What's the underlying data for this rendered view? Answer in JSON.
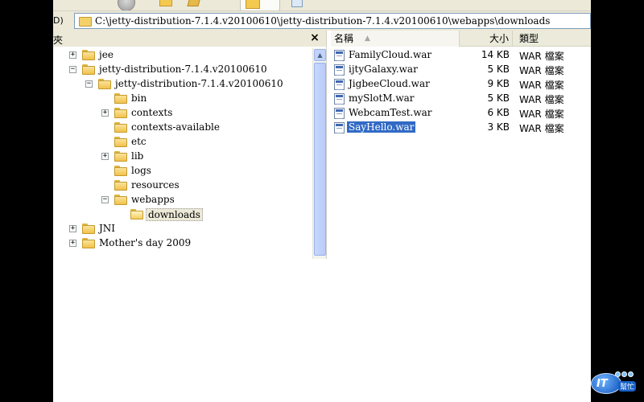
{
  "address": {
    "label": "D)",
    "path": "C:\\jetty-distribution-7.1.4.v20100610\\jetty-distribution-7.1.4.v20100610\\webapps\\downloads"
  },
  "folders_pane": {
    "title": "夾",
    "close_label": "×"
  },
  "tree": [
    {
      "label": "jee",
      "expander": "+",
      "level": 1
    },
    {
      "label": "jetty-distribution-7.1.4.v20100610",
      "expander": "−",
      "level": 1
    },
    {
      "label": "jetty-distribution-7.1.4.v20100610",
      "expander": "−",
      "level": 2
    },
    {
      "label": "bin",
      "expander": "",
      "level": 3
    },
    {
      "label": "contexts",
      "expander": "+",
      "level": 3
    },
    {
      "label": "contexts-available",
      "expander": "",
      "level": 3
    },
    {
      "label": "etc",
      "expander": "",
      "level": 3
    },
    {
      "label": "lib",
      "expander": "+",
      "level": 3
    },
    {
      "label": "logs",
      "expander": "",
      "level": 3
    },
    {
      "label": "resources",
      "expander": "",
      "level": 3
    },
    {
      "label": "webapps",
      "expander": "−",
      "level": 3
    },
    {
      "label": "downloads",
      "expander": "",
      "level": 4,
      "selected": true
    },
    {
      "label": "JNI",
      "expander": "+",
      "level": 1
    },
    {
      "label": "Mother's day 2009",
      "expander": "+",
      "level": 1
    }
  ],
  "files_pane": {
    "columns": {
      "name": "名稱",
      "size": "大小",
      "type": "類型"
    },
    "sort_indicator": "▲",
    "files": [
      {
        "name": "FamilyCloud.war",
        "size": "14 KB",
        "type": "WAR 檔案"
      },
      {
        "name": "ijtyGalaxy.war",
        "size": "5 KB",
        "type": "WAR 檔案"
      },
      {
        "name": "JigbeeCloud.war",
        "size": "9 KB",
        "type": "WAR 檔案"
      },
      {
        "name": "mySlotM.war",
        "size": "5 KB",
        "type": "WAR 檔案"
      },
      {
        "name": "WebcamTest.war",
        "size": "6 KB",
        "type": "WAR 檔案"
      },
      {
        "name": "SayHello.war",
        "size": "3 KB",
        "type": "WAR 檔案",
        "selected": true
      }
    ]
  },
  "watermark": {
    "brand": "IT",
    "tail": "幫忙"
  },
  "colors": {
    "selection": "#316ac5",
    "chrome": "#ece9d8",
    "folder": "#f1c24c"
  }
}
